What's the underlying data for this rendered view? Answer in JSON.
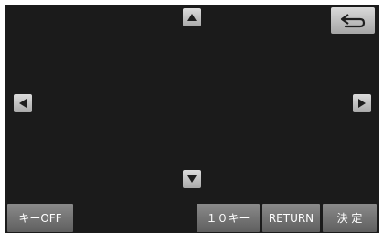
{
  "nav": {
    "up": "arrow-up-icon",
    "down": "arrow-down-icon",
    "left": "arrow-left-icon",
    "right": "arrow-right-icon",
    "back": "return-arrow-icon"
  },
  "bottom_bar": {
    "key_off": "キーOFF",
    "ten_key": "１０キー",
    "return": "RETURN",
    "enter": "決 定"
  },
  "colors": {
    "screen_background": "#1b1b1b",
    "button_gray": "#6f6f6f",
    "arrow_button_light": "#c9c9c9",
    "glyph": "#1e1e1e"
  }
}
